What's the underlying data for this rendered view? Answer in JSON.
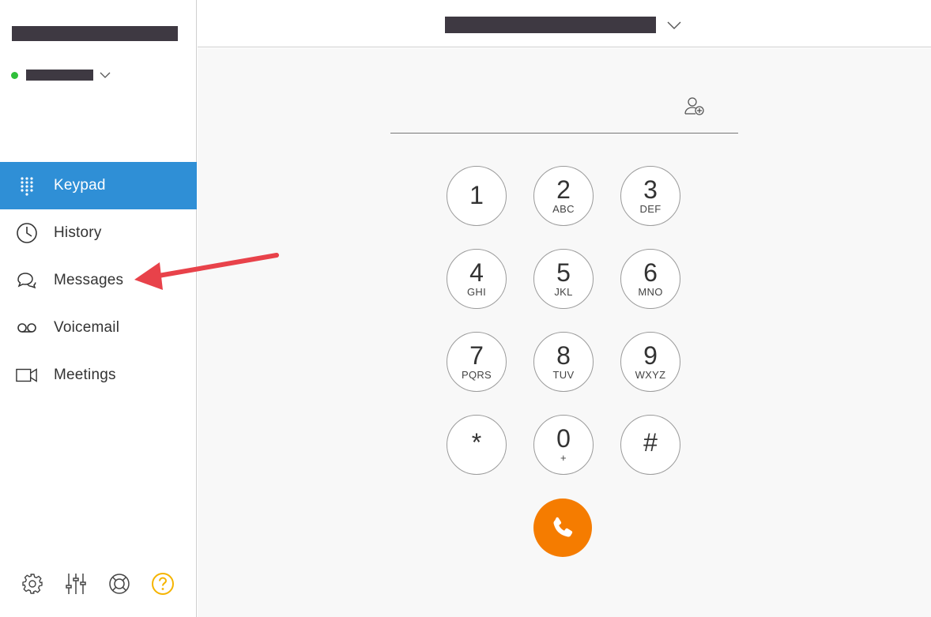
{
  "sidebar": {
    "items": [
      {
        "label": "Keypad",
        "icon": "keypad-icon",
        "active": true
      },
      {
        "label": "History",
        "icon": "clock-icon",
        "active": false
      },
      {
        "label": "Messages",
        "icon": "chat-bubbles-icon",
        "active": false
      },
      {
        "label": "Voicemail",
        "icon": "voicemail-icon",
        "active": false
      },
      {
        "label": "Meetings",
        "icon": "video-camera-icon",
        "active": false
      }
    ],
    "bottom_icons": [
      "gear-icon",
      "sliders-icon",
      "lifebuoy-icon",
      "help-icon"
    ],
    "status_color": "#2fbf3a"
  },
  "keypad": {
    "keys": [
      {
        "digit": "1",
        "letters": ""
      },
      {
        "digit": "2",
        "letters": "ABC"
      },
      {
        "digit": "3",
        "letters": "DEF"
      },
      {
        "digit": "4",
        "letters": "GHI"
      },
      {
        "digit": "5",
        "letters": "JKL"
      },
      {
        "digit": "6",
        "letters": "MNO"
      },
      {
        "digit": "7",
        "letters": "PQRS"
      },
      {
        "digit": "8",
        "letters": "TUV"
      },
      {
        "digit": "9",
        "letters": "WXYZ"
      },
      {
        "digit": "*",
        "letters": ""
      },
      {
        "digit": "0",
        "letters": "+"
      },
      {
        "digit": "#",
        "letters": ""
      }
    ]
  },
  "colors": {
    "accent": "#2f8fd6",
    "call": "#f57c00",
    "annotation_arrow": "#e8424a",
    "help": "#f5b400"
  }
}
